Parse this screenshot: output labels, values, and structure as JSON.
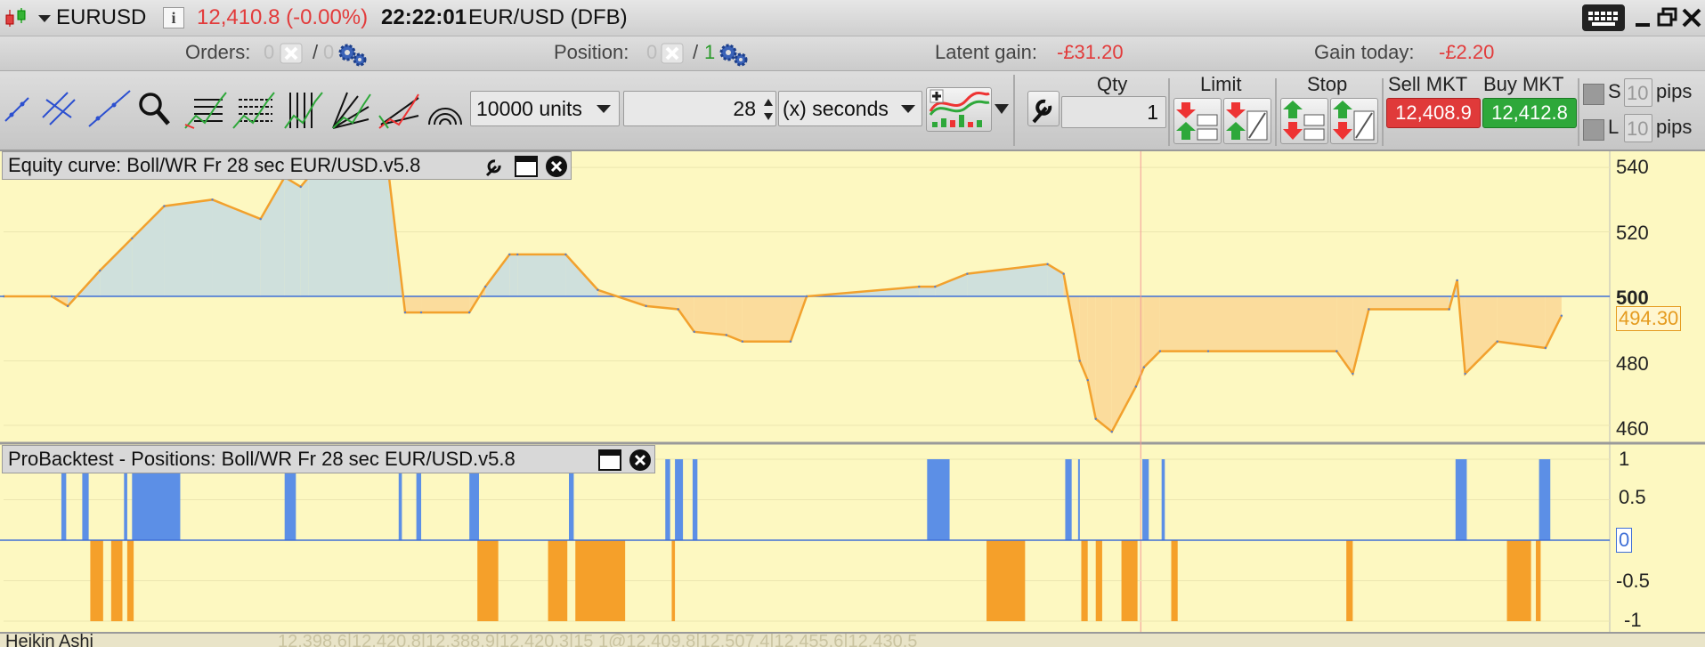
{
  "header": {
    "symbol": "EURUSD",
    "price": "12,410.8 (-0.00%)",
    "time": "22:22:01",
    "instrument": "EUR/USD (DFB)"
  },
  "status": {
    "orders_label": "Orders:",
    "orders_value": "0",
    "orders_sep": "/",
    "orders_value2": "0",
    "position_label": "Position:",
    "position_value": "0",
    "position_sep": "/",
    "position_value2": "1",
    "latent_label": "Latent gain:",
    "latent_value": "-£31.20",
    "gain_label": "Gain today:",
    "gain_value": "-£2.20"
  },
  "toolbar": {
    "units": "10000 units",
    "period": "28",
    "period_unit": "(x) seconds",
    "qty_label": "Qty",
    "qty_value": "1",
    "limit_label": "Limit",
    "stop_label": "Stop",
    "sell_label": "Sell MKT",
    "buy_label": "Buy MKT",
    "sell_price": "12,408.9",
    "buy_price": "12,412.8",
    "s_label": "S",
    "l_label": "L",
    "s_pips": "10",
    "l_pips": "10",
    "pips_label": "pips"
  },
  "pane1": {
    "title": "Equity curve: Boll/WR Fr 28 sec EUR/USD.v5.8",
    "current_value": "494.30",
    "ticks": [
      "540",
      "520",
      "500",
      "480",
      "460"
    ]
  },
  "pane2": {
    "title": "ProBacktest - Positions: Boll/WR Fr 28 sec EUR/USD.v5.8",
    "ticks": [
      "1",
      "0.5",
      "0",
      "-0.5",
      "-1"
    ]
  },
  "pane3": {
    "title": "Heikin Ashi",
    "ohlc_text": "12,398.6|12,420.8|12,388.9|12,420.3|15   1@12,409.8|12,507.4|12,455.6|12,430.5"
  },
  "colors": {
    "chart_bg": "#fdf8c1",
    "long": "#5c8fe6",
    "short": "#f5a02a",
    "equity_line": "#f2a12d",
    "equity_fill_above": "#cfe0dc",
    "equity_fill_below": "#fbdc9c",
    "zero_line": "#3f6fd6",
    "sell": "#e03a3a",
    "buy": "#2ea83a"
  },
  "chart_data": [
    {
      "type": "area",
      "title": "Equity curve: Boll/WR Fr 28 sec EUR/USD.v5.8",
      "ylim": [
        455,
        545
      ],
      "baseline": 500,
      "x": [
        0,
        3,
        4,
        6,
        8,
        10,
        13,
        16,
        17.5,
        18.5,
        19,
        24,
        25,
        26,
        29,
        30,
        31.5,
        32,
        35,
        37,
        40,
        42,
        43,
        45,
        46,
        49,
        50,
        57,
        58,
        60,
        65,
        66,
        67,
        67.5,
        68,
        69,
        70.5,
        71,
        72,
        75,
        83,
        84,
        85,
        90,
        90.5,
        91,
        93,
        96,
        97
      ],
      "y": [
        500,
        500,
        497,
        508,
        518,
        528,
        530,
        524,
        537,
        534,
        537,
        537,
        495,
        495,
        495,
        503,
        513,
        513,
        513,
        502,
        497,
        496,
        489,
        488,
        486,
        486,
        500,
        503,
        503,
        507,
        510,
        507,
        480,
        474,
        462,
        458,
        472,
        478,
        483,
        483,
        483,
        476,
        496,
        496,
        505,
        476,
        486,
        484,
        494
      ]
    },
    {
      "type": "bar",
      "title": "ProBacktest - Positions: Boll/WR Fr 28 sec EUR/USD.v5.8",
      "ylim": [
        -1,
        1
      ],
      "long_periods": [
        [
          3.6,
          3.9
        ],
        [
          4.9,
          5.3
        ],
        [
          7.5,
          7.7
        ],
        [
          8.0,
          11.0
        ],
        [
          17.5,
          18.2
        ],
        [
          24.6,
          24.8
        ],
        [
          25.7,
          26.0
        ],
        [
          29.0,
          29.6
        ],
        [
          35.2,
          35.5
        ],
        [
          41.2,
          41.5
        ],
        [
          41.8,
          42.3
        ],
        [
          42.9,
          43.2
        ],
        [
          57.5,
          58.9
        ],
        [
          66.1,
          66.5
        ],
        [
          66.9,
          67.0
        ],
        [
          70.9,
          71.3
        ],
        [
          72.1,
          72.3
        ],
        [
          90.4,
          91.1
        ],
        [
          95.6,
          96.3
        ]
      ],
      "short_periods": [
        [
          5.4,
          6.2
        ],
        [
          6.7,
          7.4
        ],
        [
          7.7,
          8.1
        ],
        [
          29.5,
          30.8
        ],
        [
          33.9,
          35.1
        ],
        [
          35.6,
          38.7
        ],
        [
          41.6,
          41.8
        ],
        [
          61.2,
          63.6
        ],
        [
          67.1,
          67.5
        ],
        [
          68.0,
          68.4
        ],
        [
          69.6,
          70.6
        ],
        [
          72.7,
          73.1
        ],
        [
          83.6,
          84.0
        ],
        [
          93.6,
          95.1
        ],
        [
          95.4,
          95.7
        ]
      ]
    }
  ]
}
